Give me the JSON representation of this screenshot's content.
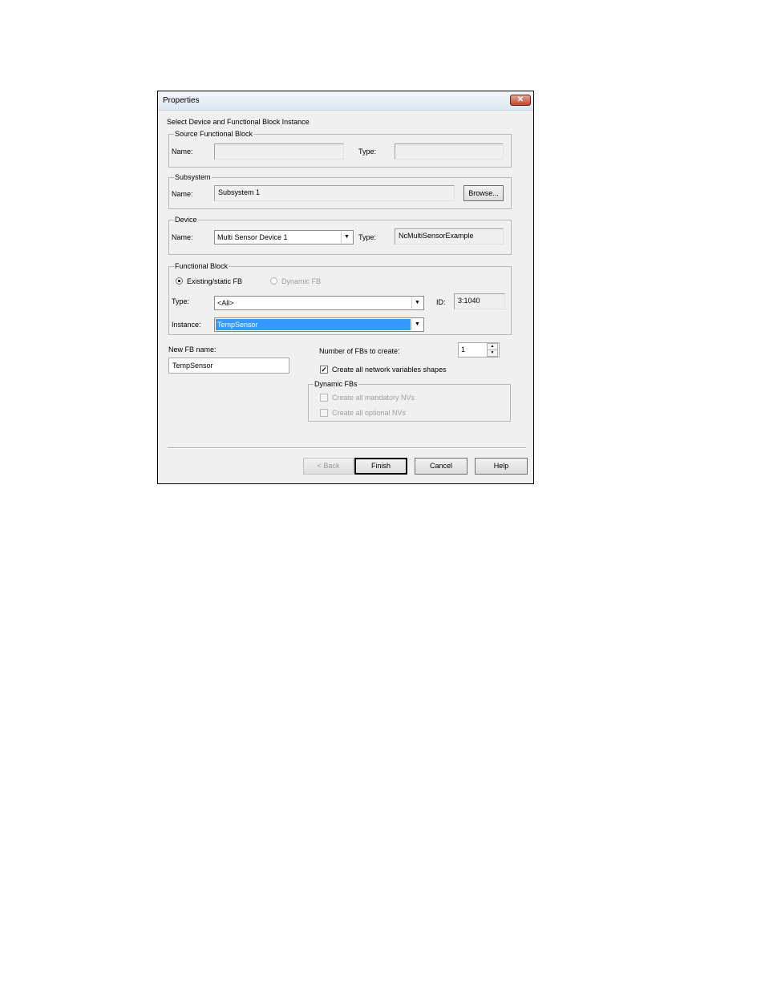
{
  "window": {
    "title": "Properties",
    "close_symbol": "✕"
  },
  "header": {
    "instruction": "Select Device and Functional Block Instance"
  },
  "source_fb": {
    "legend": "Source Functional Block",
    "name_label": "Name:",
    "name_value": "",
    "type_label": "Type:",
    "type_value": ""
  },
  "subsystem": {
    "legend": "Subsystem",
    "name_label": "Name:",
    "name_value": "Subsystem 1",
    "browse_label": "Browse..."
  },
  "device": {
    "legend": "Device",
    "name_label": "Name:",
    "name_selected": "Multi Sensor Device 1",
    "type_label": "Type:",
    "type_value": "NcMultiSensorExample"
  },
  "functional_block": {
    "legend": "Functional Block",
    "existing_label": "Existing/static FB",
    "existing_checked": true,
    "dynamic_label": "Dynamic FB",
    "dynamic_enabled": false,
    "type_label": "Type:",
    "type_selected": "<All>",
    "id_label": "ID:",
    "id_value": "3:1040",
    "instance_label": "Instance:",
    "instance_selected": "TempSensor"
  },
  "new_fb": {
    "label": "New FB name:",
    "value": "TempSensor"
  },
  "count": {
    "label": "Number of FBs to create:",
    "value": "1"
  },
  "create_nv_shapes": {
    "label": "Create all network variables shapes",
    "checked": true
  },
  "dynamic_fbs": {
    "legend": "Dynamic FBs",
    "mandatory_label": "Create all mandatory NVs",
    "optional_label": "Create all optional NVs"
  },
  "buttons": {
    "back": "< Back",
    "finish": "Finish",
    "cancel": "Cancel",
    "help": "Help"
  },
  "icons": {
    "dropdown": "▼",
    "spin_up": "▲",
    "spin_down": "▼",
    "check": "✓"
  }
}
